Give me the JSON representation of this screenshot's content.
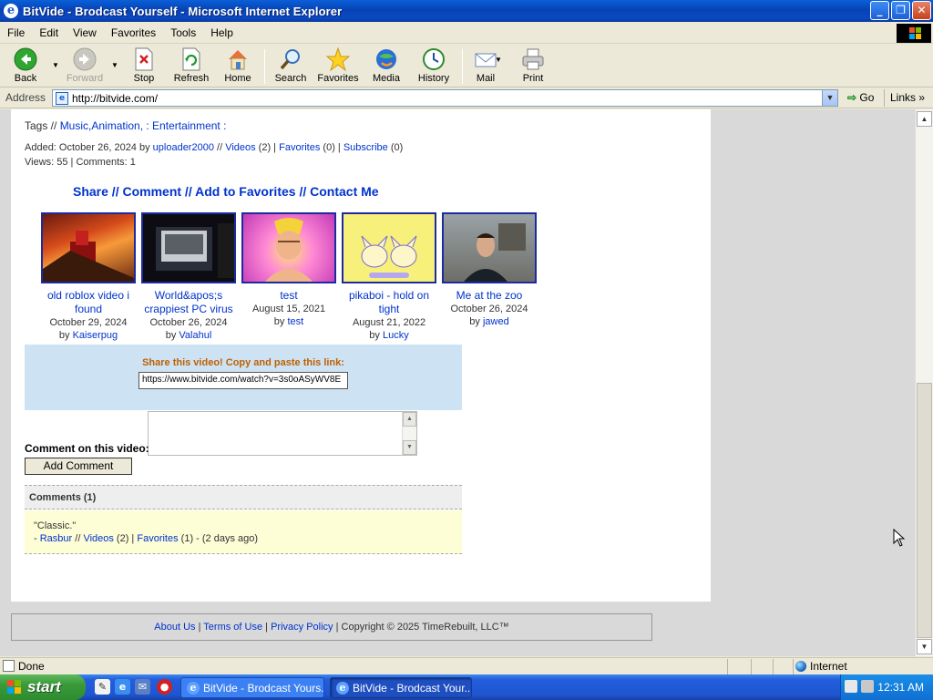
{
  "window": {
    "title": "BitVide - Brodcast Yourself - Microsoft Internet Explorer",
    "minimize": "_",
    "maximize": "❐",
    "close": "✕"
  },
  "menu": [
    "File",
    "Edit",
    "View",
    "Favorites",
    "Tools",
    "Help"
  ],
  "toolbar": {
    "back": "Back",
    "forward": "Forward",
    "stop": "Stop",
    "refresh": "Refresh",
    "home": "Home",
    "search": "Search",
    "favorites": "Favorites",
    "media": "Media",
    "history": "History",
    "mail": "Mail",
    "print": "Print"
  },
  "address": {
    "label": "Address",
    "url": "http://bitvide.com/",
    "go": "Go",
    "links": "Links"
  },
  "video": {
    "tags_prefix": "Tags // ",
    "tags": "Music,Animation, : Entertainment :",
    "added_prefix": "Added: October 26, 2024 by ",
    "uploader": "uploader2000",
    "sep1": " // ",
    "videos_link": "Videos",
    "videos_count": " (2) | ",
    "favorites_link": "Favorites",
    "favorites_count": " (0) | ",
    "subscribe_link": "Subscribe",
    "subscribe_count": " (0)",
    "stats": "Views: 55 | Comments: 1"
  },
  "actions": {
    "share": "Share",
    "comment": "Comment",
    "add_favorites": "Add to Favorites",
    "contact": "Contact Me",
    "separator": " // "
  },
  "related": [
    {
      "title": "old roblox video i found",
      "date": "October 29, 2024",
      "by": "by ",
      "user": "Kaiserpug"
    },
    {
      "title": "World&apos;s crappiest PC virus",
      "date": "October 26, 2024",
      "by": "by ",
      "user": "Valahul"
    },
    {
      "title": "test",
      "date": "August 15, 2021",
      "by": "by ",
      "user": "test"
    },
    {
      "title": "pikaboi - hold on tight",
      "date": "August 21, 2022",
      "by": "by ",
      "user": "Lucky"
    },
    {
      "title": "Me at the zoo",
      "date": "October 26, 2024",
      "by": "by ",
      "user": "jawed"
    }
  ],
  "share_box": {
    "label": "Share this video! Copy and paste this link:",
    "link": "https://www.bitvide.com/watch?v=3s0oASyWV8E"
  },
  "comment_form": {
    "label": "Comment on this video:",
    "button": "Add Comment"
  },
  "comments": {
    "header": "Comments (1)",
    "items": [
      {
        "text": "\"Classic.\"",
        "prefix": "- ",
        "user": "Rasbur",
        "sep": " // ",
        "videos": "Videos",
        "videos_count": " (2) | ",
        "favorites": "Favorites",
        "favorites_count": " (1) - (2 days ago)"
      }
    ]
  },
  "footer": {
    "about": "About Us",
    "terms": "Terms of Use",
    "privacy": "Privacy Policy",
    "sep": " | ",
    "copyright": "Copyright © 2025 TimeRebuilt, LLC™"
  },
  "statusbar": {
    "text": "Done",
    "zone": "Internet"
  },
  "taskbar": {
    "start": "start",
    "tasks": [
      "BitVide - Brodcast Yours...",
      "BitVide - Brodcast Your..."
    ],
    "clock": "12:31 AM"
  },
  "colors": {
    "link": "#0033cc",
    "thumb_border": "#1e2aa0",
    "share_bg": "#cde3f3",
    "share_label": "#c06000",
    "comment_bg": "#fdfdd6"
  }
}
